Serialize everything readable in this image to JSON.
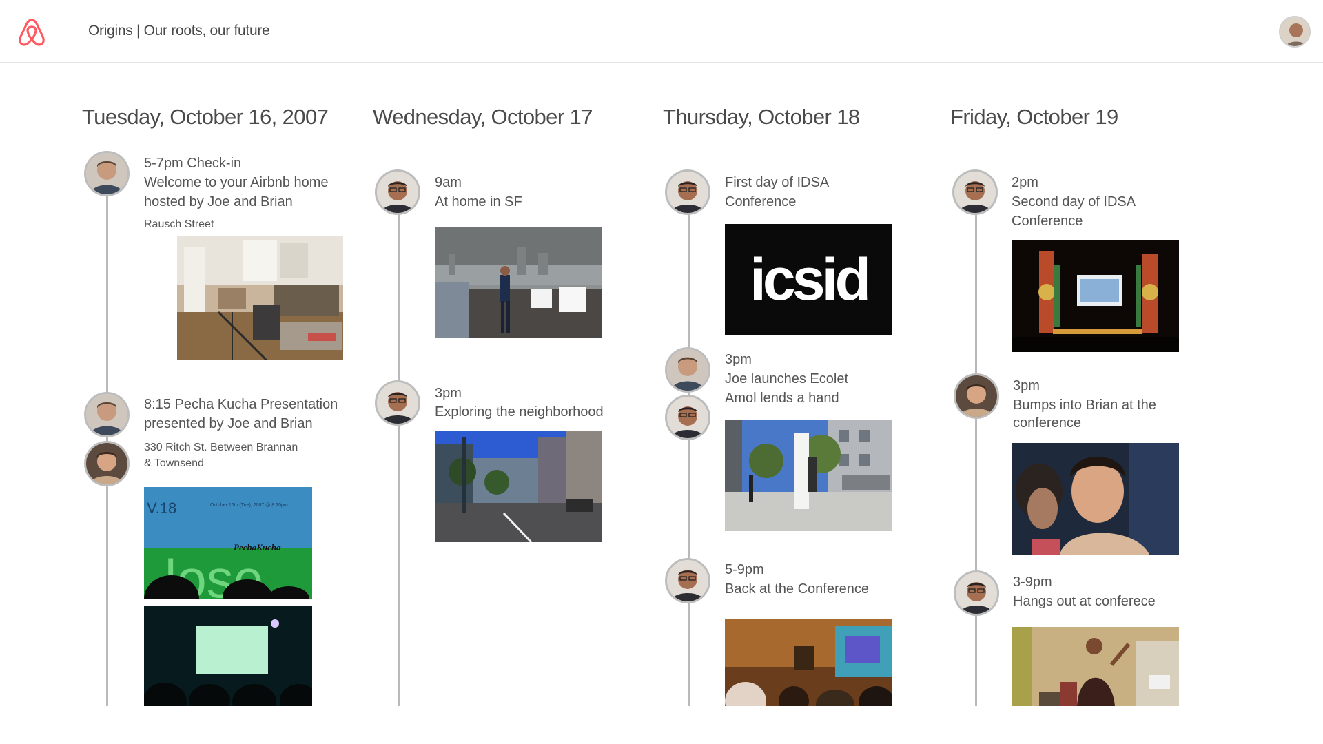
{
  "app": {
    "title": "Origins | Our roots, our future",
    "logo_icon": "airbnb-belo-icon",
    "brand_color": "#FF5A5F"
  },
  "days": [
    {
      "heading": "Tuesday, October 16, 2007",
      "events": [
        {
          "time": "5-7pm Check-in",
          "line1": "Welcome to your Airbnb home",
          "line2": "hosted by Joe and Brian",
          "location": "Rausch Street"
        },
        {
          "time": "8:15 Pecha Kucha Presentation",
          "line1": "presented by Joe and Brian",
          "location_line1": "330 Ritch St. Between Brannan",
          "location_line2": "& Townsend"
        }
      ]
    },
    {
      "heading": "Wednesday, October 17",
      "events": [
        {
          "time": "9am",
          "line1": "At home in SF"
        },
        {
          "time": "3pm",
          "line1": "Exploring the neighborhood"
        }
      ]
    },
    {
      "heading": "Thursday, October 18",
      "events": [
        {
          "line1": "First day of IDSA",
          "line2": "Conference",
          "photo_text": "icsid"
        },
        {
          "time": "3pm",
          "line1": "Joe launches Ecolet",
          "line2": "Amol lends a hand"
        },
        {
          "time": "5-9pm",
          "line1": "Back at the Conference"
        }
      ]
    },
    {
      "heading": "Friday, October 19",
      "events": [
        {
          "time": "2pm",
          "line1": "Second day of IDSA",
          "line2": "Conference"
        },
        {
          "time": "3pm",
          "line1": "Bumps into Brian at the",
          "line2": "conference"
        },
        {
          "time": "3-9pm",
          "line1": "Hangs out at conferece"
        }
      ]
    }
  ],
  "slide_photo_text": {
    "v18": "V.18",
    "date_line": "October 16th (Tue), 2007 @ 8:20pm",
    "brand": "PechaKucha",
    "big_letters": "lose"
  }
}
